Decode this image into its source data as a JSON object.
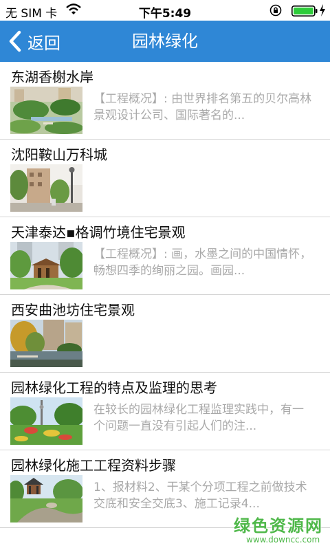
{
  "status": {
    "carrier": "无 SIM 卡",
    "time": "下午5:49",
    "icons": [
      "wifi-icon",
      "orientation-lock-icon",
      "battery-icon",
      "charging-icon"
    ]
  },
  "nav": {
    "back_label": "返回",
    "title": "园林绿化",
    "background": "#2f87d6"
  },
  "items": [
    {
      "title": "东湖香榭水岸",
      "summary": "【工程概况】: 由世界排名第五的贝尔高林景观设计公司、国际著名的..."
    },
    {
      "title": "沈阳鞍山万科城",
      "summary": ""
    },
    {
      "title": "天津泰达▪格调竹境住宅景观",
      "summary": "【工程概况】: 画，水墨之间的中国情怀，畅想四季的绚丽之园。画园..."
    },
    {
      "title": "西安曲池坊住宅景观",
      "summary": ""
    },
    {
      "title": "园林绿化工程的特点及监理的思考",
      "summary": "在较长的园林绿化工程监理实践中，有一个问题一直没有引起人们的注..."
    },
    {
      "title": "园林绿化施工工程资料步骤",
      "summary": "1、报材料2、干某个分项工程之前做技术交底和安全交底3、施工记录4..."
    }
  ],
  "watermark": {
    "main": "绿色资源网",
    "sub": "www.downcc.com"
  }
}
